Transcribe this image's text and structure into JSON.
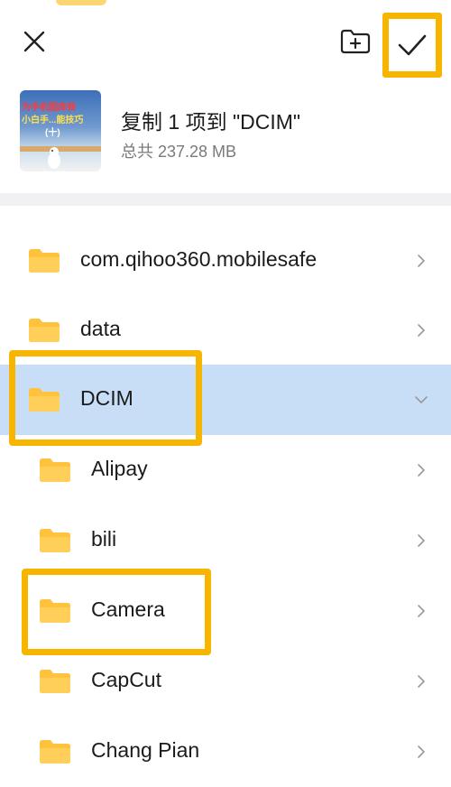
{
  "header": {
    "close_icon": "close-icon",
    "new_folder_icon": "new-folder-icon",
    "confirm_icon": "checkmark-icon"
  },
  "copy_info": {
    "title": "复制 1 项到 \"DCIM\"",
    "subtitle": "总共 237.28 MB",
    "thumbnail_caption_1": "为手机图库我",
    "thumbnail_caption_2": "小白手...能技巧",
    "thumbnail_caption_3": "(十)"
  },
  "folders": [
    {
      "name": "com.qihoo360.mobilesafe",
      "expanded": false,
      "level": 0
    },
    {
      "name": "data",
      "expanded": false,
      "level": 0
    },
    {
      "name": "DCIM",
      "expanded": true,
      "level": 0,
      "selected": true
    },
    {
      "name": "Alipay",
      "expanded": false,
      "level": 1
    },
    {
      "name": "bili",
      "expanded": false,
      "level": 1
    },
    {
      "name": "Camera",
      "expanded": false,
      "level": 1
    },
    {
      "name": "CapCut",
      "expanded": false,
      "level": 1
    },
    {
      "name": "Chang Pian",
      "expanded": false,
      "level": 1
    }
  ],
  "colors": {
    "highlight": "#f7b500",
    "selected_row": "#c8ddf6",
    "folder": "#ffc23d"
  }
}
